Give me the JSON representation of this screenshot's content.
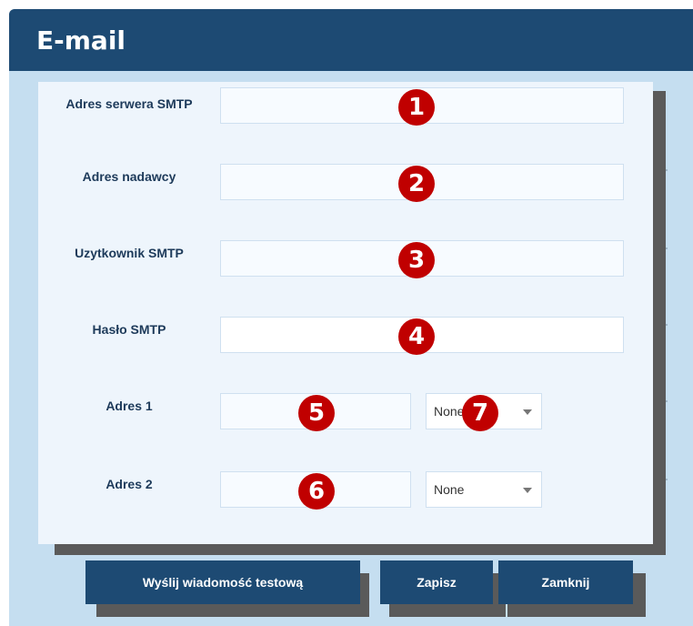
{
  "window": {
    "title": "E-mail"
  },
  "form": {
    "smtp_server_label": "Adres serwera SMTP",
    "sender_label": "Adres nadawcy",
    "smtp_user_label": "Uzytkownik SMTP",
    "smtp_password_label": "Hasło SMTP",
    "address1_label": "Adres 1",
    "address2_label": "Adres 2",
    "address1_select_value": "None",
    "address2_select_value": "None"
  },
  "badges": [
    "1",
    "2",
    "3",
    "4",
    "5",
    "6",
    "7"
  ],
  "buttons": {
    "test_label": "Wyślij wiadomość testową",
    "save_label": "Zapisz",
    "close_label": "Zamknij"
  },
  "colors": {
    "header": "#1d4a73",
    "background": "#c5def0",
    "badge": "#c00000"
  }
}
